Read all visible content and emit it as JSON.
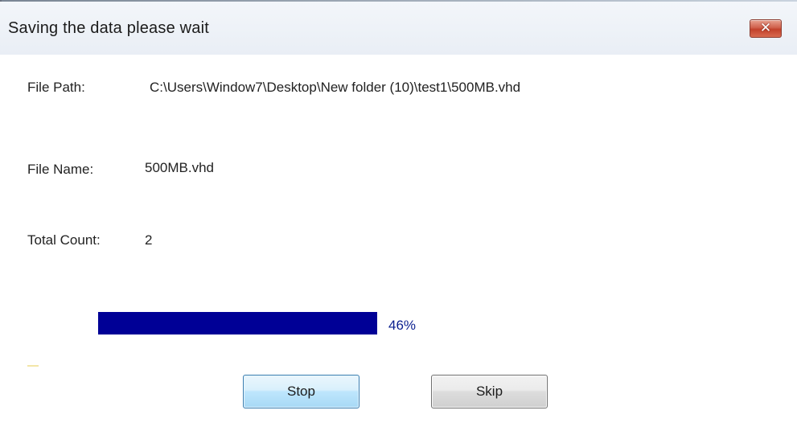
{
  "window": {
    "title": "Saving the data please wait",
    "close_icon": "close-icon",
    "close_glyph": "✕"
  },
  "fields": {
    "file_path_label": "File Path:",
    "file_path_value": "C:\\Users\\Window7\\Desktop\\New folder (10)\\test1\\500MB.vhd",
    "file_name_label": "File Name:",
    "file_name_value": "500MB.vhd",
    "total_count_label": "Total Count:",
    "total_count_value": "2"
  },
  "progress": {
    "percent": 46,
    "percent_text": "46%",
    "fill_color": "#000096",
    "text_color": "#0a1f8f"
  },
  "buttons": {
    "stop_label": "Stop",
    "skip_label": "Skip"
  },
  "colors": {
    "close_button": "#c2412b",
    "focused_button_border": "#3c7fb1"
  }
}
